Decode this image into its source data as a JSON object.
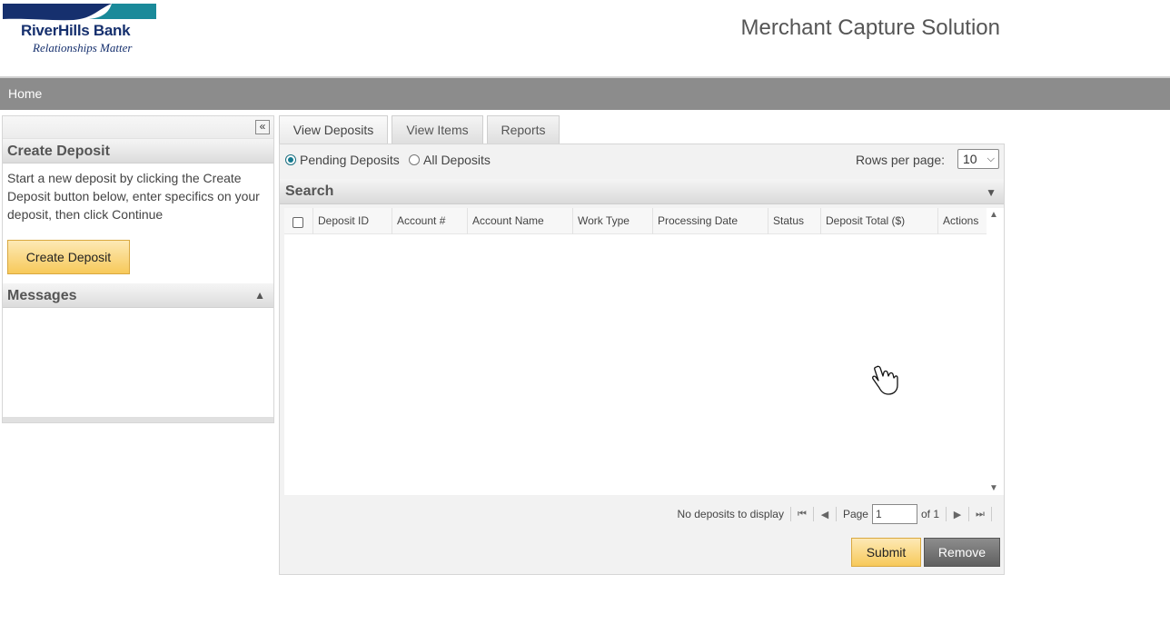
{
  "header": {
    "logo_bank_name": "RiverHills Bank",
    "logo_tagline": "Relationships Matter",
    "app_title": "Merchant Capture Solution",
    "brand_color": "#16306e",
    "accent_color": "#1a8a9a"
  },
  "nav": {
    "home": "Home"
  },
  "left_panel": {
    "collapse_icon": "«",
    "create_deposit": {
      "title": "Create Deposit",
      "description": "Start a new deposit by clicking the Create Deposit button below, enter specifics on your deposit, then click Continue",
      "button_label": "Create Deposit"
    },
    "messages": {
      "title": "Messages",
      "toggle_icon": "▲"
    }
  },
  "tabs": [
    {
      "label": "View Deposits",
      "active": true
    },
    {
      "label": "View Items",
      "active": false
    },
    {
      "label": "Reports",
      "active": false
    }
  ],
  "filters": {
    "pending_deposits": "Pending Deposits",
    "all_deposits": "All Deposits",
    "selected": "pending",
    "rows_per_page_label": "Rows per page:",
    "rows_per_page_value": "10"
  },
  "search": {
    "title": "Search",
    "toggle_icon": "▼"
  },
  "grid": {
    "columns": [
      "Deposit ID",
      "Account #",
      "Account Name",
      "Work Type",
      "Processing Date",
      "Status",
      "Deposit Total ($)",
      "Actions"
    ],
    "rows": []
  },
  "pager": {
    "status": "No deposits to display",
    "page_label": "Page",
    "page_value": "1",
    "of_label": "of 1"
  },
  "actions": {
    "submit": "Submit",
    "remove": "Remove"
  }
}
